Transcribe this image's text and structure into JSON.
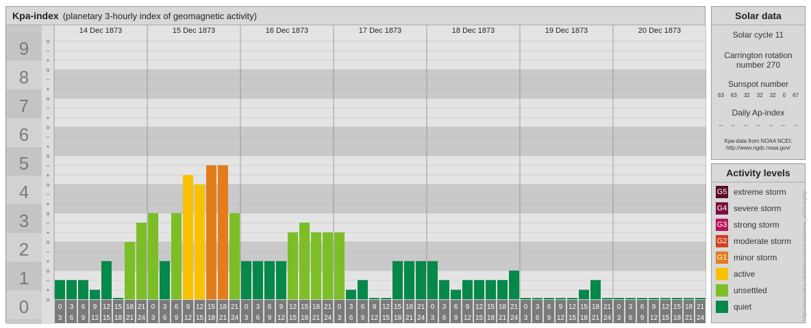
{
  "header": {
    "title": "Kpa-index",
    "subtitle": "(planetary 3-hourly index of geomagnetic activity)"
  },
  "solar": {
    "title": "Solar data",
    "cycle": "Solar cycle 11",
    "rotation_line1": "Carrington rotation",
    "rotation_line2": "number 270",
    "sunspot_label": "Sunspot number",
    "sunspot_values": [
      "63",
      "63",
      "32",
      "32",
      "32",
      "0",
      "67"
    ],
    "ap_label": "Daily Ap-index",
    "ap_values": [
      "--",
      "--",
      "--",
      "--",
      "--",
      "--",
      "--"
    ],
    "source_line1": "Kpa-data from NOAA NCEI:",
    "source_line2": "http://www.ngdc.noaa.gov/"
  },
  "activity": {
    "title": "Activity levels",
    "levels": [
      {
        "badge": "G5",
        "label": "extreme storm",
        "color": "#5a0a2a"
      },
      {
        "badge": "G4",
        "label": "severe storm",
        "color": "#7a1040"
      },
      {
        "badge": "G3",
        "label": "strong storm",
        "color": "#b8145a"
      },
      {
        "badge": "G2",
        "label": "moderate storm",
        "color": "#d0401c"
      },
      {
        "badge": "G1",
        "label": "minor storm",
        "color": "#e27d1c"
      },
      {
        "badge": "",
        "label": "active",
        "color": "#f8c200"
      },
      {
        "badge": "",
        "label": "unsettled",
        "color": "#7cbe26"
      },
      {
        "badge": "",
        "label": "quiet",
        "color": "#06884a"
      }
    ]
  },
  "credit": "http://www.tesis.lebedev.ru/aurora/aurora_archive.php",
  "chart_data": {
    "type": "bar",
    "dates": [
      "14 Dec 1873",
      "15 Dec 1873",
      "16 Dec 1873",
      "17 Dec 1873",
      "18 Dec 1873",
      "19 Dec 1873",
      "20 Dec 1873"
    ],
    "y_ticks": [
      "0",
      "1",
      "2",
      "3",
      "4",
      "5",
      "6",
      "7",
      "8",
      "9"
    ],
    "ylim": [
      0,
      9
    ],
    "minor_labels": [
      "o",
      "+",
      "–"
    ],
    "hour_start_labels": [
      "0",
      "3",
      "6",
      "9",
      "12",
      "15",
      "18",
      "21"
    ],
    "hour_end_labels": [
      "3",
      "6",
      "9",
      "12",
      "15",
      "18",
      "21",
      "24"
    ],
    "values": [
      0.67,
      0.67,
      0.67,
      0.33,
      1.33,
      0,
      2.0,
      2.67,
      3.0,
      1.33,
      3.0,
      4.33,
      4.0,
      4.67,
      4.67,
      3.0,
      1.33,
      1.33,
      1.33,
      1.33,
      2.33,
      2.67,
      2.33,
      2.33,
      2.33,
      0.33,
      0.67,
      0,
      0,
      1.33,
      1.33,
      1.33,
      1.33,
      0.67,
      0.33,
      0.67,
      0.67,
      0.67,
      0.67,
      1.0,
      0,
      0,
      0,
      0,
      0,
      0.33,
      0.67,
      0,
      0,
      0,
      0,
      0,
      0,
      0,
      0,
      0
    ],
    "colors": {
      "quiet": "#06884a",
      "unsettled": "#7cbe26",
      "active": "#f8c200",
      "G1": "#e27d1c"
    }
  }
}
